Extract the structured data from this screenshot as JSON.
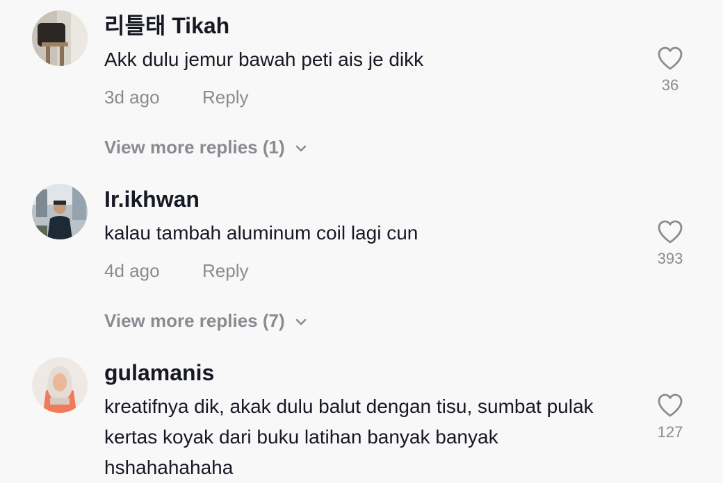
{
  "comments": [
    {
      "username": "리틀태 Tikah",
      "text": "Akk dulu jemur bawah peti ais je dikk",
      "time": "3d ago",
      "reply_label": "Reply",
      "likes": "36",
      "view_more": "View more replies (1)",
      "avatar_icon": "user-avatar-photo"
    },
    {
      "username": "Ir.ikhwan",
      "text": "kalau tambah aluminum coil lagi cun",
      "time": "4d ago",
      "reply_label": "Reply",
      "likes": "393",
      "view_more": "View more replies (7)",
      "avatar_icon": "user-avatar-photo"
    },
    {
      "username": "gulamanis",
      "text": "kreatifnya dik, akak dulu balut dengan tisu, sumbat pulak kertas koyak dari buku latihan banyak banyak hshahahahaha",
      "likes": "127",
      "avatar_icon": "user-avatar-photo"
    }
  ],
  "icons": {
    "like": "heart-outline-icon",
    "expand": "chevron-down-icon"
  },
  "colors": {
    "background": "#f8f8f8",
    "primary_text": "#161823",
    "secondary_text": "#8a8b91"
  }
}
